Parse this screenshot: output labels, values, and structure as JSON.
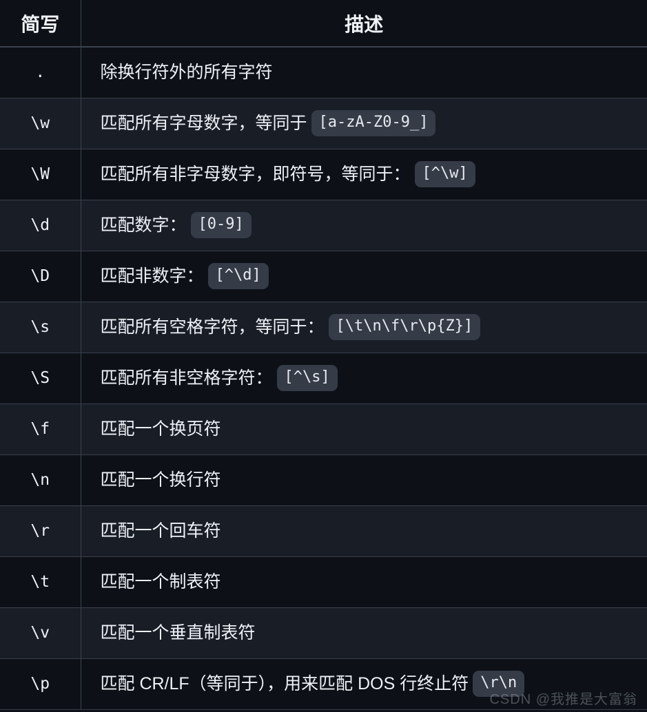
{
  "table": {
    "columns": [
      {
        "key": "abbr",
        "label": "简写"
      },
      {
        "key": "desc",
        "label": "描述"
      }
    ],
    "rows": [
      {
        "abbr": ".",
        "desc": "除换行符外的所有字符",
        "code": ""
      },
      {
        "abbr": "\\w",
        "desc": "匹配所有字母数字，等同于",
        "code": "[a-zA-Z0-9_]"
      },
      {
        "abbr": "\\W",
        "desc": "匹配所有非字母数字，即符号，等同于：",
        "code": "[^\\w]"
      },
      {
        "abbr": "\\d",
        "desc": "匹配数字：",
        "code": "[0-9]"
      },
      {
        "abbr": "\\D",
        "desc": "匹配非数字：",
        "code": "[^\\d]"
      },
      {
        "abbr": "\\s",
        "desc": "匹配所有空格字符，等同于：",
        "code": "[\\t\\n\\f\\r\\p{Z}]"
      },
      {
        "abbr": "\\S",
        "desc": "匹配所有非空格字符：",
        "code": "[^\\s]"
      },
      {
        "abbr": "\\f",
        "desc": "匹配一个换页符",
        "code": ""
      },
      {
        "abbr": "\\n",
        "desc": "匹配一个换行符",
        "code": ""
      },
      {
        "abbr": "\\r",
        "desc": "匹配一个回车符",
        "code": ""
      },
      {
        "abbr": "\\t",
        "desc": "匹配一个制表符",
        "code": ""
      },
      {
        "abbr": "\\v",
        "desc": "匹配一个垂直制表符",
        "code": ""
      },
      {
        "abbr": "\\p",
        "desc": "匹配 CR/LF（等同于），用来匹配 DOS 行终止符",
        "code": "\\r\\n"
      }
    ]
  },
  "watermark": {
    "text": "CSDN @我推是大富翁"
  },
  "colors": {
    "page_background": "#0d1117",
    "row_dark": "#0d1117",
    "row_light": "#191d26",
    "border": "#39404c",
    "text": "#eef1f6",
    "code_badge_background": "#353b47"
  }
}
